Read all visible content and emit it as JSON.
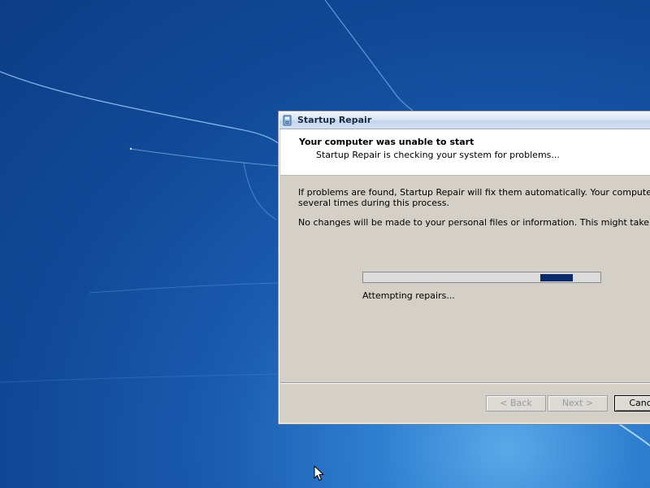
{
  "window": {
    "title": "Startup Repair",
    "icon": "startup-repair-icon"
  },
  "header": {
    "title": "Your computer was unable to start",
    "subtitle": "Startup Repair is checking your system for problems..."
  },
  "body": {
    "paragraph1_line1": "If problems are found, Startup Repair will fix them automatically. Your computer might restart",
    "paragraph1_line2": "several times during this process.",
    "paragraph2": "No changes will be made to your personal files or information. This might take several minutes."
  },
  "progress": {
    "style": "marquee",
    "status": "Attempting repairs...",
    "chunk_color": "#0b2a6b"
  },
  "buttons": {
    "back": "< Back",
    "next": "Next >",
    "cancel": "Cancel"
  },
  "colors": {
    "desktop": "#124a98",
    "dialog_face": "#d4d0c8"
  }
}
